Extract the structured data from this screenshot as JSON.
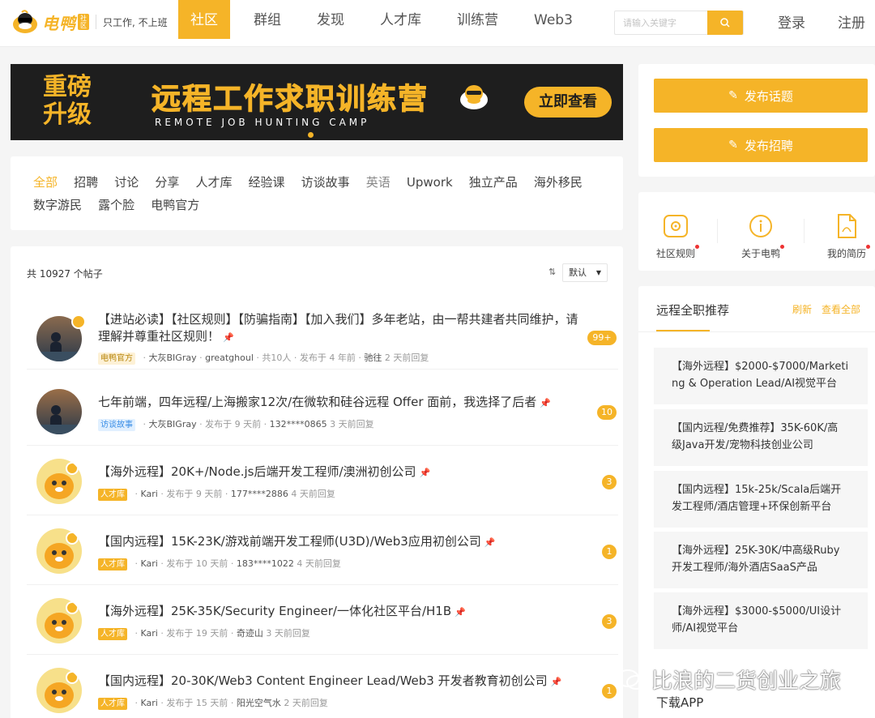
{
  "brand": {
    "name": "电鸭",
    "badge": "社区",
    "slogan": "只工作, 不上班"
  },
  "nav": {
    "items": [
      "社区",
      "群组",
      "发现",
      "人才库",
      "训练营",
      "Web3"
    ],
    "active": 0
  },
  "search": {
    "placeholder": "请输入关键字"
  },
  "auth": {
    "login": "登录",
    "register": "注册"
  },
  "banner": {
    "badge_line1": "重磅",
    "badge_line2": "升级",
    "title": "远程工作求职训练营",
    "subtitle": "REMOTE JOB HUNTING CAMP",
    "cta": "立即查看"
  },
  "categories": {
    "items": [
      "全部",
      "招聘",
      "讨论",
      "分享",
      "人才库",
      "经验课",
      "访谈故事",
      "英语",
      "Upwork",
      "独立产品",
      "海外移民",
      "数字游民",
      "露个脸",
      "电鸭官方"
    ],
    "active": 0
  },
  "posts": {
    "total": "共 10927 个帖子",
    "sort": "默认",
    "items": [
      {
        "title": "【进站必读】【社区规则】【防骗指南】【加入我们】多年老站，由一帮共建者共同维护，请理解并尊重社区规则！",
        "tag": "电鸭官方",
        "author": "大灰BIGray",
        "coauthor": "greatghoul",
        "extra": "· 共10人 · 发布于 4 年前 · ",
        "last": "驰往",
        "reply": "2 天前回复",
        "count": "99+"
      },
      {
        "title": "七年前端，四年远程/上海搬家12次/在微软和硅谷远程 Offer 面前，我选择了后者",
        "tag": "访谈故事",
        "author": "大灰BIGray",
        "coauthor": "",
        "extra": "· 发布于 9 天前 · ",
        "last": "132****0865",
        "reply": "3 天前回复",
        "count": "10"
      },
      {
        "title": "【海外远程】20K+/Node.js后端开发工程师/澳洲初创公司",
        "tag": "人才库",
        "author": "Kari",
        "coauthor": "",
        "extra": "· 发布于 9 天前 · ",
        "last": "177****2886",
        "reply": "4 天前回复",
        "count": "3"
      },
      {
        "title": "【国内远程】15K-23K/游戏前端开发工程师(U3D)/Web3应用初创公司",
        "tag": "人才库",
        "author": "Kari",
        "coauthor": "",
        "extra": "· 发布于 10 天前 · ",
        "last": "183****1022",
        "reply": "4 天前回复",
        "count": "1"
      },
      {
        "title": "【海外远程】25K-35K/Security Engineer/一体化社区平台/H1B",
        "tag": "人才库",
        "author": "Kari",
        "coauthor": "",
        "extra": "· 发布于 19 天前 · ",
        "last": "奇迹山",
        "reply": "3 天前回复",
        "count": "3"
      },
      {
        "title": "【国内远程】20-30K/Web3 Content Engineer Lead/Web3 开发者教育初创公司",
        "tag": "人才库",
        "author": "Kari",
        "coauthor": "",
        "extra": "· 发布于 15 天前 · ",
        "last": "阳光空气水",
        "reply": "2 天前回复",
        "count": "1"
      }
    ]
  },
  "sidebar": {
    "publish_topic": "发布话题",
    "publish_job": "发布招聘",
    "quick_links": [
      "社区规则",
      "关于电鸭",
      "我的简历"
    ],
    "recommend": {
      "title": "远程全职推荐",
      "refresh": "刷新",
      "view_all": "查看全部",
      "jobs": [
        [
          "【海外远程】$2000-$7000/Marketi",
          "ng & Operation Lead/AI视觉平台"
        ],
        [
          "【国内远程/免费推荐】35K-60K/高",
          "级Java开发/宠物科技创业公司"
        ],
        [
          "【国内远程】15k-25k/Scala后端开",
          "发工程师/酒店管理+环保创新平台"
        ],
        [
          "【海外远程】25K-30K/中高级Ruby",
          "开发工程师/海外酒店SaaS产品"
        ],
        [
          "【海外远程】$3000-$5000/UI设计",
          "师/AI视觉平台"
        ]
      ]
    },
    "download_app": "下载APP"
  },
  "watermark": "比浪的二货创业之旅",
  "colors": {
    "accent": "#f5b428",
    "banner_bg": "#1e1e1e",
    "tag_official": "#fdf1d6",
    "tag_interview": "#e1f0ff",
    "tag_talent": "#f5b428"
  }
}
